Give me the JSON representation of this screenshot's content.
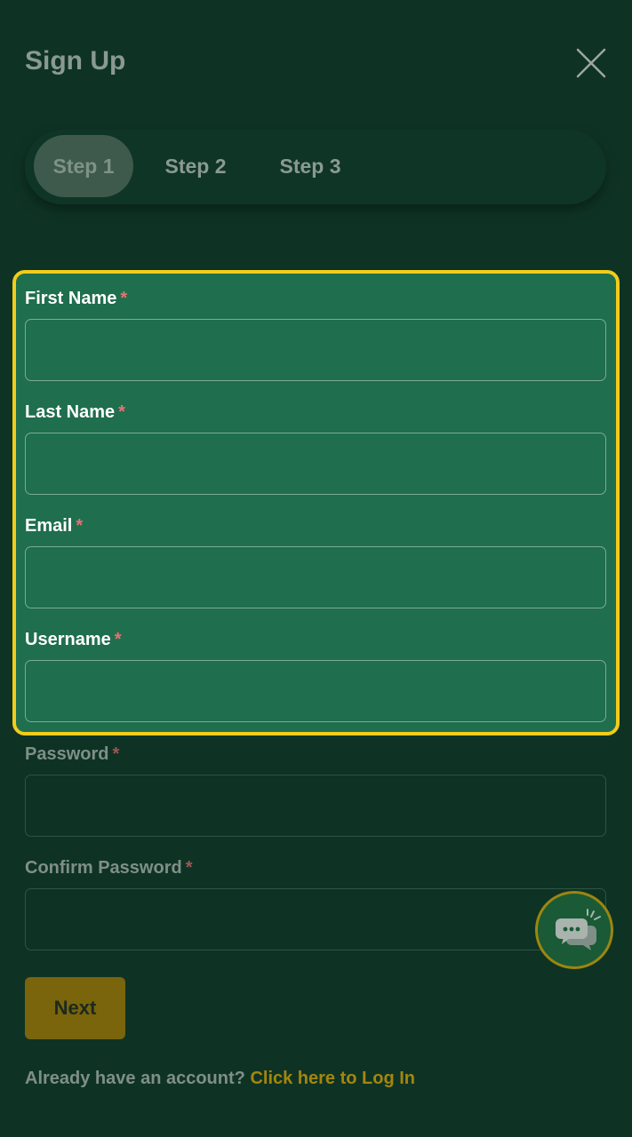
{
  "header": {
    "title": "Sign Up"
  },
  "steps": [
    {
      "label": "Step 1",
      "active": true
    },
    {
      "label": "Step 2",
      "active": false
    },
    {
      "label": "Step 3",
      "active": false
    }
  ],
  "form": {
    "fields": [
      {
        "label": "First Name",
        "value": "",
        "required": "*"
      },
      {
        "label": "Last Name",
        "value": "",
        "required": "*"
      },
      {
        "label": "Email",
        "value": "",
        "required": "*"
      },
      {
        "label": "Username",
        "value": "",
        "required": "*"
      },
      {
        "label": "Password",
        "value": "",
        "required": "*"
      },
      {
        "label": "Confirm Password",
        "value": "",
        "required": "*"
      }
    ],
    "next_label": "Next"
  },
  "footer": {
    "prompt": "Already have an account?",
    "link": "Click here to Log In"
  },
  "icons": {
    "close": "close-icon",
    "chat": "chat-bubbles-icon"
  },
  "colors": {
    "background": "#0e3324",
    "highlight_border": "#f2cc1a",
    "highlight_fill": "#1f6e4e",
    "button": "#7a640c",
    "link": "#a3860e",
    "required_star": "#e57373"
  }
}
